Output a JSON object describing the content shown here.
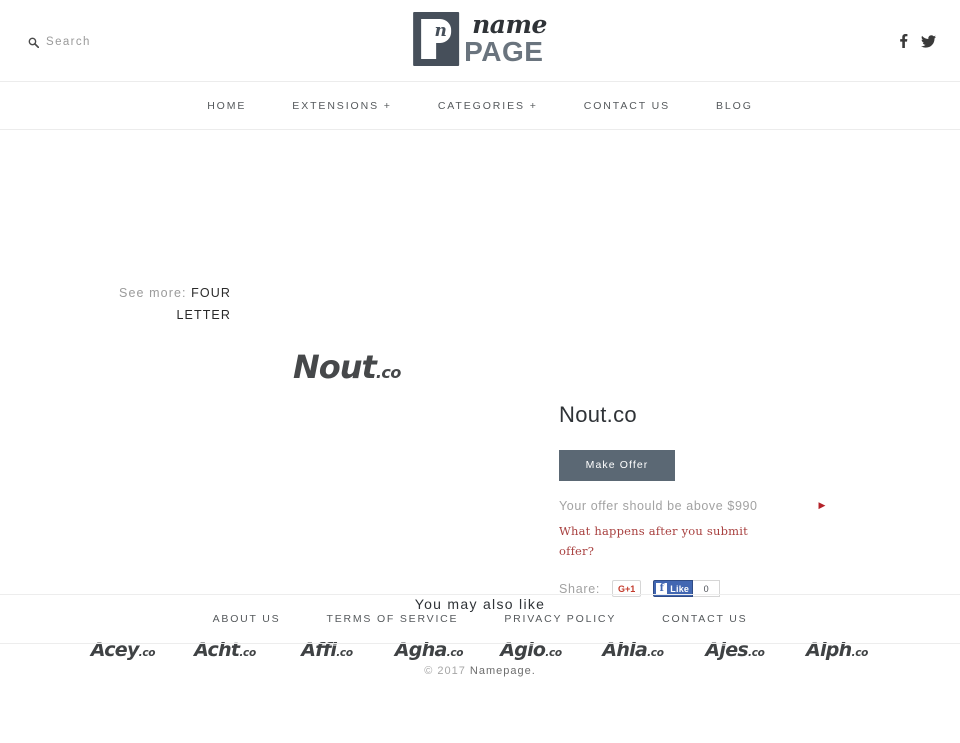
{
  "header": {
    "search": {
      "label": "Search",
      "icon": "search-icon"
    },
    "logo": {
      "mark_letter": "n",
      "name": "name",
      "page": "PAGE"
    },
    "social": [
      {
        "name": "facebook-icon",
        "label": "f"
      },
      {
        "name": "twitter-icon",
        "label": "t"
      }
    ]
  },
  "nav": {
    "items": [
      {
        "label": "HOME"
      },
      {
        "label": "EXTENSIONS +"
      },
      {
        "label": "CATEGORIES +"
      },
      {
        "label": "CONTACT US"
      },
      {
        "label": "BLOG"
      }
    ]
  },
  "seemore": {
    "label": "See more:",
    "link": "FOUR LETTER"
  },
  "main": {
    "domain_art_name": "Nout",
    "domain_art_tld": ".co",
    "domain_title": "Nout.co",
    "make_offer_label": "Make Offer",
    "offer_note": "Your offer should be above $990",
    "offer_arrow": "▶",
    "offer_faq": "What happens after you submit offer?",
    "share_label": "Share:",
    "gplus_label": "G+1",
    "fb_f": "f",
    "fb_like_label": "Like",
    "fb_count": "0"
  },
  "alsolike": {
    "title": "You may also like",
    "items": [
      {
        "name": "Acey",
        "tld": ".co"
      },
      {
        "name": "Acht",
        "tld": ".co"
      },
      {
        "name": "Affi",
        "tld": ".co"
      },
      {
        "name": "Agha",
        "tld": ".co"
      },
      {
        "name": "Agio",
        "tld": ".co"
      },
      {
        "name": "Ahla",
        "tld": ".co"
      },
      {
        "name": "Ajes",
        "tld": ".co"
      },
      {
        "name": "Alph",
        "tld": ".co"
      }
    ]
  },
  "footer": {
    "links": [
      {
        "label": "ABOUT US"
      },
      {
        "label": "TERMS OF SERVICE"
      },
      {
        "label": "PRIVACY POLICY"
      },
      {
        "label": "CONTACT US"
      }
    ],
    "copyright_prefix": "© 2017 ",
    "copyright_brand": "Namepage."
  },
  "colors": {
    "accent_button": "#5b6874",
    "logo_mark": "#464f5a",
    "logo_page": "#6a747e",
    "link_red": "#a8403f",
    "arrow_red": "#b4232a",
    "facebook_blue": "#4267b2",
    "gplus_red": "#c33a2b",
    "text_dark": "#2f3337",
    "text_muted": "#a2a2a2",
    "rule": "#ececec"
  }
}
